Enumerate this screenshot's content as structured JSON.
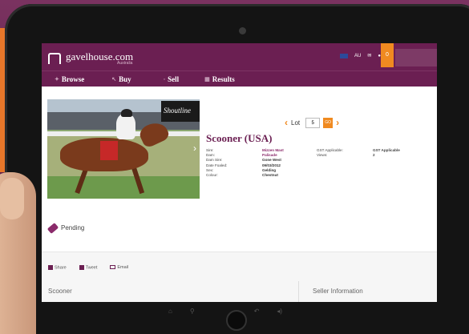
{
  "brand": {
    "name": "gavelhouse.com",
    "sub": "Australia"
  },
  "topbar": {
    "region": "AU",
    "badge_count": "0"
  },
  "menu": [
    {
      "label": "Browse"
    },
    {
      "label": "Buy"
    },
    {
      "label": "Sell"
    },
    {
      "label": "Results"
    }
  ],
  "photo": {
    "sign_text": "Shoutline"
  },
  "lot": {
    "label": "Lot",
    "value": "5",
    "go": "GO"
  },
  "listing": {
    "title": "Scooner (USA)",
    "details": [
      {
        "key": "Sire:",
        "value": "Mizzen Mast",
        "link": true
      },
      {
        "key": "Dam:",
        "value": "Palisade",
        "link": true
      },
      {
        "key": "Dam Sire:",
        "value": "Gone West",
        "link": false
      },
      {
        "key": "Date Foaled:",
        "value": "09/03/2012",
        "link": false
      },
      {
        "key": "Sex:",
        "value": "Gelding",
        "link": false
      },
      {
        "key": "Colour:",
        "value": "Chestnut",
        "link": false
      }
    ],
    "details_right": [
      {
        "key": "GST Applicable:",
        "value": "GST Applicable"
      },
      {
        "key": "Views:",
        "value": "2"
      }
    ]
  },
  "status": {
    "label": "Pending"
  },
  "share": {
    "share": "Share",
    "tweet": "Tweet",
    "email": "Email"
  },
  "sections": {
    "left": "Scooner",
    "right": "Seller Information"
  },
  "colors": {
    "brand_purple": "#6b1f52",
    "accent_orange": "#f08a20"
  }
}
